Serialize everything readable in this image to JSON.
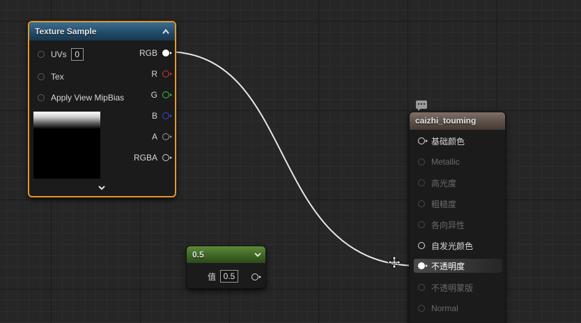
{
  "texture_node": {
    "title": "Texture Sample",
    "inputs": [
      {
        "label": "UVs",
        "value": "0"
      },
      {
        "label": "Tex"
      },
      {
        "label": "Apply View MipBias"
      }
    ],
    "outputs": [
      "RGB",
      "R",
      "G",
      "B",
      "A",
      "RGBA"
    ],
    "colors": {
      "R": "#d23a3a",
      "G": "#3ec43e",
      "B": "#3a49d8",
      "A": "#9a9a9a",
      "RGBA": "#d0d0d0"
    }
  },
  "constant_node": {
    "title": "0.5",
    "value_label": "值",
    "value": "0.5"
  },
  "material_node": {
    "title": "caizhi_touming",
    "pins": [
      {
        "label": "基础颜色",
        "active": true
      },
      {
        "label": "Metallic",
        "active": false
      },
      {
        "label": "高光度",
        "active": false
      },
      {
        "label": "粗糙度",
        "active": false
      },
      {
        "label": "各向异性",
        "active": false
      },
      {
        "label": "自发光颜色",
        "active": true
      },
      {
        "label": "不透明度",
        "active": true,
        "connected": true
      },
      {
        "label": "不透明蒙版",
        "active": false
      },
      {
        "label": "Normal",
        "active": false
      }
    ]
  }
}
